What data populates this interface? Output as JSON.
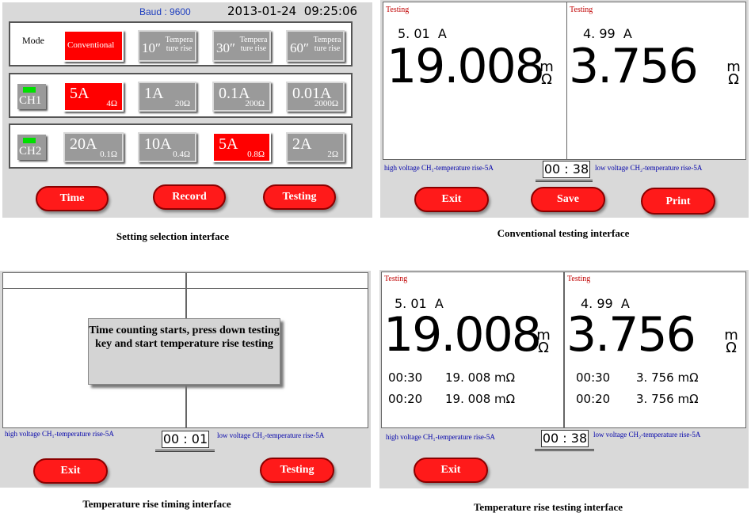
{
  "settings": {
    "baud": "Baud : 9600",
    "datetime": "2013-01-24  09:25:06",
    "mode_label": "Mode",
    "mode_buttons": [
      {
        "label": "Conventional",
        "selected": true
      },
      {
        "main": "10″",
        "sub": "Tempera ture rise"
      },
      {
        "main": "30″",
        "sub": "Tempera ture rise"
      },
      {
        "main": "60″",
        "sub": "Tempera ture rise"
      }
    ],
    "ch1_label": "CH1",
    "ch1_buttons": [
      {
        "current": "5A",
        "resistance": "4Ω",
        "selected": true
      },
      {
        "current": "1A",
        "resistance": "20Ω"
      },
      {
        "current": "0.1A",
        "resistance": "200Ω"
      },
      {
        "current": "0.01A",
        "resistance": "2000Ω"
      }
    ],
    "ch2_label": "CH2",
    "ch2_buttons": [
      {
        "current": "20A",
        "resistance": "0.1Ω"
      },
      {
        "current": "10A",
        "resistance": "0.4Ω"
      },
      {
        "current": "5A",
        "resistance": "0.8Ω",
        "selected": true
      },
      {
        "current": "2A",
        "resistance": "2Ω"
      }
    ],
    "buttons": {
      "time": "Time",
      "record": "Record",
      "testing": "Testing"
    },
    "caption": "Setting selection interface"
  },
  "conventional": {
    "left": {
      "status": "Testing",
      "current": "5. 01  A",
      "reading": "19.008",
      "unit_top": "m",
      "unit_bottom": "Ω"
    },
    "right": {
      "status": "Testing",
      "current": "4. 99  A",
      "reading": "3.756",
      "unit_top": "m",
      "unit_bottom": "Ω"
    },
    "footer_left": "high voltage CH₁-temperature rise-5A",
    "footer_right": "low voltage CH₂-temperature rise-5A",
    "timer": "00 : 38",
    "buttons": {
      "exit": "Exit",
      "save": "Save",
      "print": "Print"
    },
    "caption": "Conventional testing interface"
  },
  "timing": {
    "message": "Time counting starts, press down testing key and start temperature rise testing",
    "footer_left": "high voltage CH₁-temperature rise-5A",
    "footer_right": "low voltage CH₂-temperature rise-5A",
    "timer": "00 : 01",
    "buttons": {
      "exit": "Exit",
      "testing": "Testing"
    },
    "caption": "Temperature rise timing interface"
  },
  "rise": {
    "left": {
      "status": "Testing",
      "current": "5. 01  A",
      "reading": "19.008",
      "unit_top": "m",
      "unit_bottom": "Ω",
      "records": [
        {
          "time": "00:30",
          "value": "19. 008 mΩ"
        },
        {
          "time": "00:20",
          "value": "19. 008 mΩ"
        }
      ]
    },
    "right": {
      "status": "Testing",
      "current": "4. 99  A",
      "reading": "3.756",
      "unit_top": "m",
      "unit_bottom": "Ω",
      "records": [
        {
          "time": "00:30",
          "value": "3. 756 mΩ"
        },
        {
          "time": "00:20",
          "value": "3. 756 mΩ"
        }
      ]
    },
    "footer_left": "high voltage CH₁-temperature rise-5A",
    "footer_right": "low voltage CH₂-temperature rise-5A",
    "timer": "00 : 38",
    "buttons": {
      "exit": "Exit"
    },
    "caption": "Temperature rise testing interface"
  }
}
